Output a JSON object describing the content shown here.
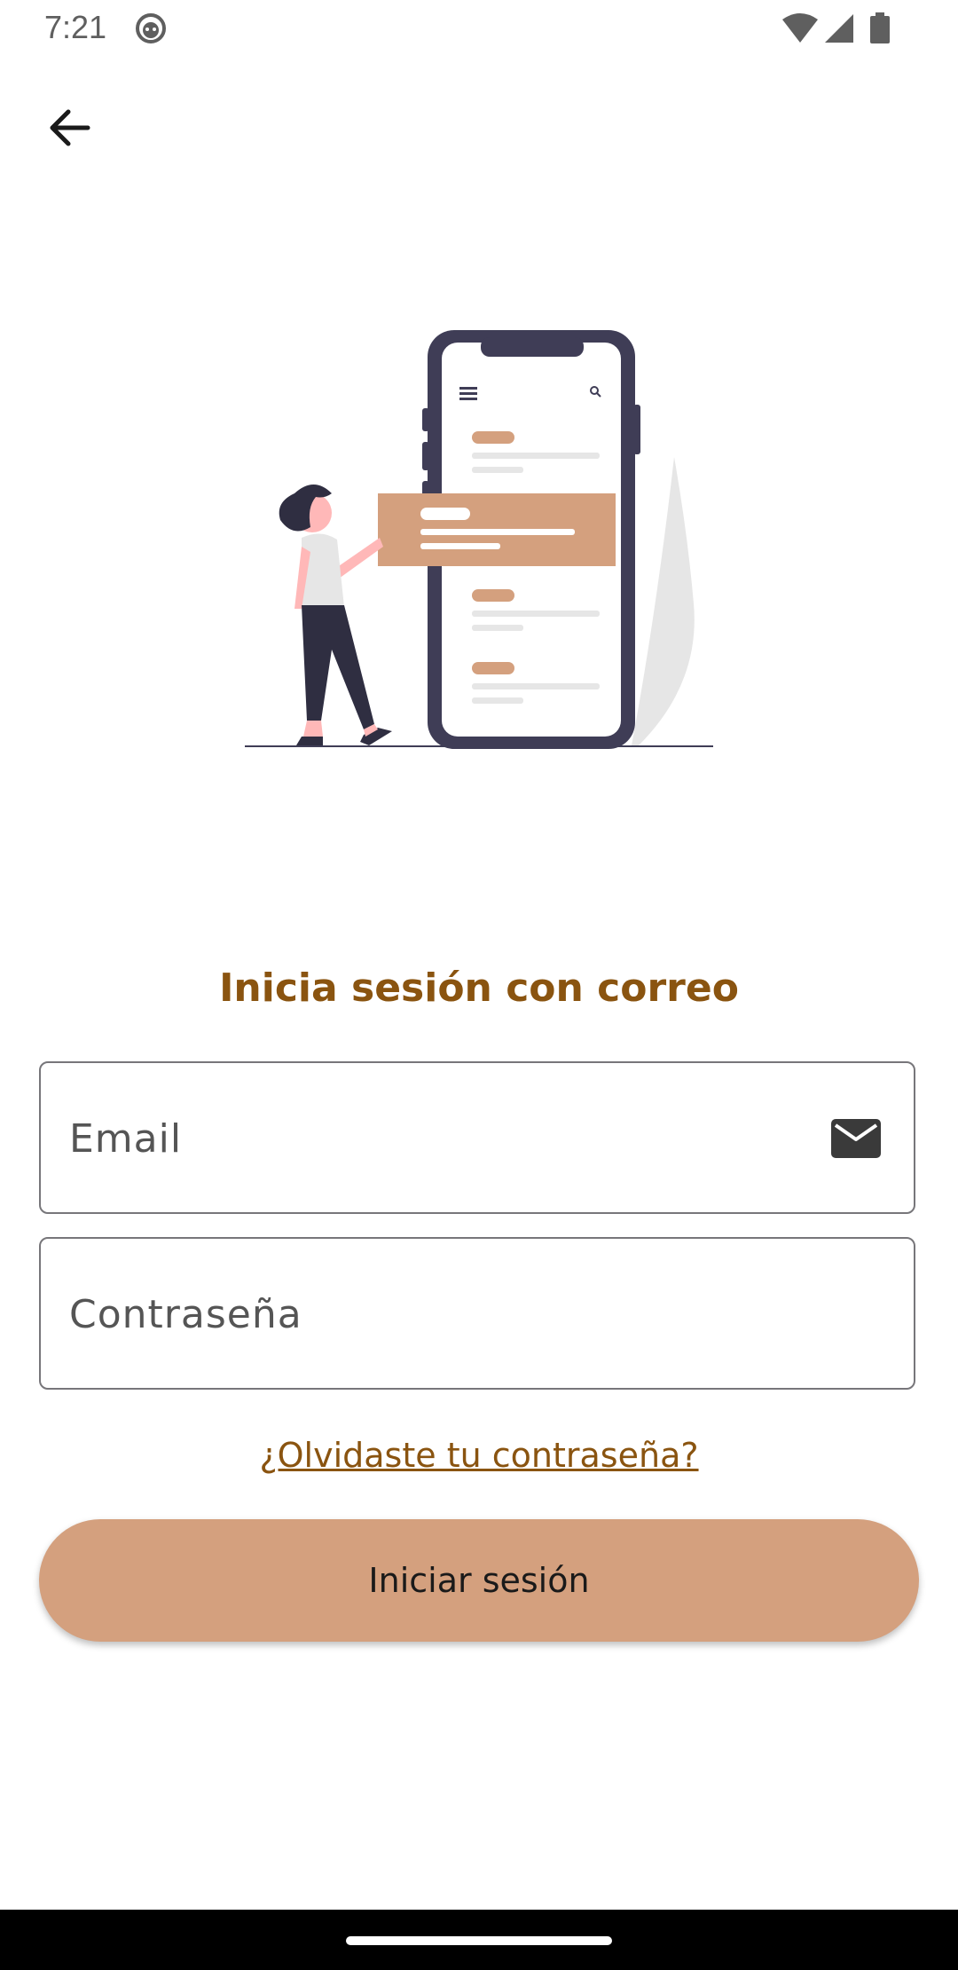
{
  "status_bar": {
    "time": "7:21",
    "icons": [
      "face-icon",
      "wifi-icon",
      "signal-icon",
      "battery-icon"
    ]
  },
  "header": {
    "back_icon": "arrow-left-icon"
  },
  "illustration": {
    "description_icon": "person-with-phone-illustration",
    "colors": {
      "accent": "#d4a07e",
      "phone": "#3f3d56",
      "skin": "#ffb8b8"
    }
  },
  "login": {
    "title": "Inicia sesión con correo",
    "email_placeholder": "Email",
    "email_icon": "mail-icon",
    "password_placeholder": "Contraseña",
    "forgot_password": "¿Olvidaste tu contraseña?",
    "submit_label": "Iniciar sesión"
  },
  "theme": {
    "title_color": "#8a5410",
    "button_color": "#d4a07e",
    "border_color": "#77767a"
  }
}
